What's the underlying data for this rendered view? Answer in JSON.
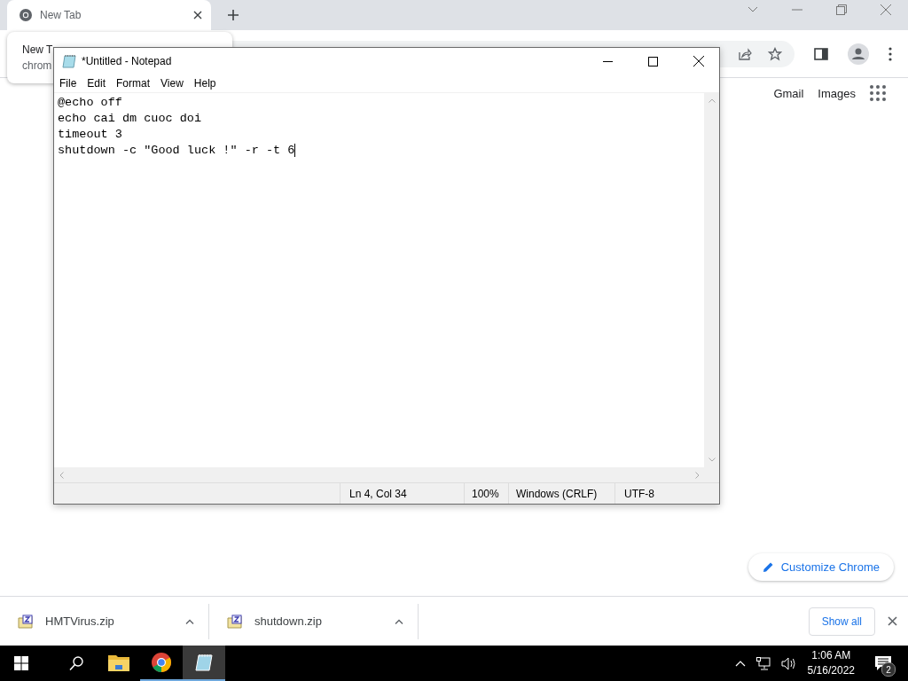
{
  "browser": {
    "tabs": [
      {
        "title": "New Tab",
        "selected": true
      }
    ],
    "tooltip": {
      "title": "New T",
      "url": "chrom"
    },
    "links": [
      "Gmail",
      "Images"
    ],
    "customize_button": "Customize Chrome"
  },
  "notepad": {
    "title": "*Untitled - Notepad",
    "menu": [
      "File",
      "Edit",
      "Format",
      "View",
      "Help"
    ],
    "lines": [
      "@echo off",
      "echo cai dm cuoc doi",
      "timeout 3",
      "shutdown -c \"Good luck !\" -r -t 6"
    ],
    "status": {
      "position": "Ln 4, Col 34",
      "zoom": "100%",
      "line_ending": "Windows (CRLF)",
      "encoding": "UTF-8"
    }
  },
  "downloads": {
    "items": [
      {
        "name": "HMTVirus.zip"
      },
      {
        "name": "shutdown.zip"
      }
    ],
    "show_all": "Show all"
  },
  "taskbar": {
    "apps": [
      {
        "kind": "explorer",
        "running": false,
        "selected": false
      },
      {
        "kind": "chrome",
        "running": true,
        "selected": false
      },
      {
        "kind": "notepad",
        "running": true,
        "selected": true
      }
    ],
    "time": "1:06 AM",
    "date": "5/16/2022",
    "notifications": "2"
  }
}
